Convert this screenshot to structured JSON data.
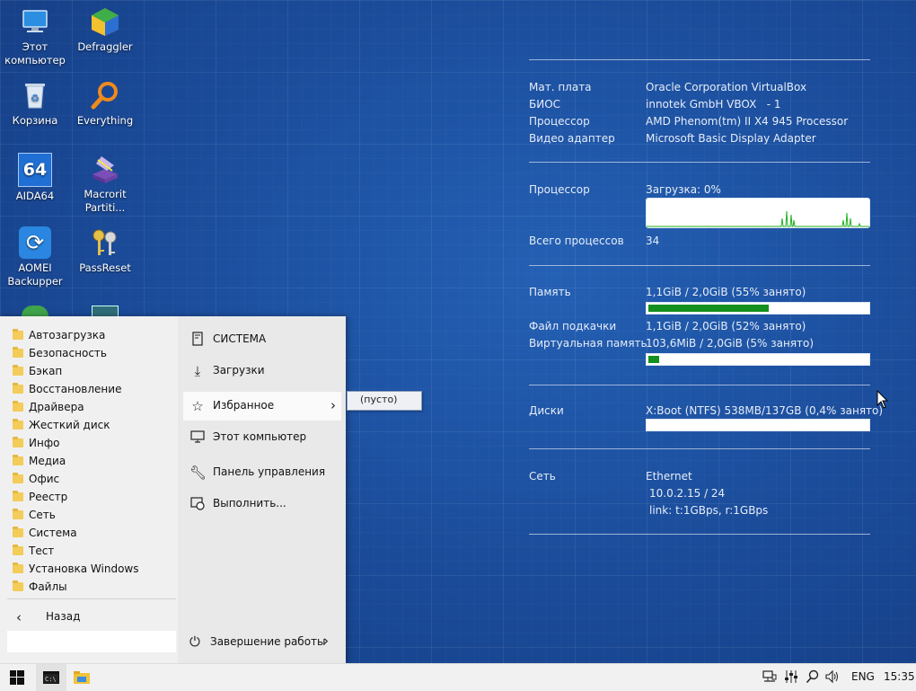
{
  "desktop": {
    "icons": [
      {
        "label": "Этот компьютер"
      },
      {
        "label": "Defraggler"
      },
      {
        "label": "Корзина"
      },
      {
        "label": "Everything"
      },
      {
        "label": "AIDA64",
        "badge": "64"
      },
      {
        "label": "Macrorit Partiti..."
      },
      {
        "label": "AOMEI Backupper"
      },
      {
        "label": "PassReset"
      }
    ]
  },
  "sysinfo": {
    "motherboard": {
      "label": "Мат. плата",
      "value": "Oracle Corporation VirtualBox"
    },
    "bios": {
      "label": "БИОС",
      "value": "innotek GmbH VBOX   - 1"
    },
    "cpu": {
      "label": "Процессор",
      "value": "AMD Phenom(tm) II X4 945 Processor"
    },
    "video": {
      "label": "Видео адаптер",
      "value": "Microsoft Basic Display Adapter"
    },
    "cpu_load": {
      "label": "Процессор",
      "value": "Загрузка:  0%"
    },
    "processes": {
      "label": "Всего процессов",
      "value": "34"
    },
    "memory": {
      "label": "Память",
      "value": "1,1GiB / 2,0GiB (55% занято)",
      "percent": 55
    },
    "pagefile": {
      "label": "Файл подкачки",
      "value": "1,1GiB / 2,0GiB (52% занято)"
    },
    "virtual": {
      "label": "Виртуальная память",
      "value": "103,6MiB / 2,0GiB (5% занято)",
      "percent": 5
    },
    "disks": {
      "label": "Диски",
      "value": "X:Boot (NTFS) 538MB/137GB (0,4% занято)",
      "percent": 0.4
    },
    "network": {
      "label": "Сеть",
      "adapter": "Ethernet",
      "ip": "10.0.2.15 / 24",
      "link": "link: t:1GBps, r:1GBps"
    }
  },
  "startmenu": {
    "folders": [
      "Автозагрузка",
      "Безопасность",
      "Бэкап",
      "Восстановление",
      "Драйвера",
      "Жесткий диск",
      "Инфо",
      "Медиа",
      "Офис",
      "Реестр",
      "Сеть",
      "Система",
      "Тест",
      "Установка Windows",
      "Файлы"
    ],
    "back_label": "Назад",
    "search_placeholder": "",
    "right_items": {
      "system": "СИСТЕМА",
      "downloads": "Загрузки",
      "favorites": "Избранное",
      "this_pc": "Этот компьютер",
      "control_panel": "Панель управления",
      "run": "Выполнить..."
    },
    "shutdown_label": "Завершение работы",
    "favorites_popup": "(пусто)"
  },
  "taskbar": {
    "language": "ENG",
    "time": "15:35"
  },
  "colors": {
    "desktop_bg": "#1c4f9e",
    "bar_fill": "#13901e",
    "menu_bg": "#e9e9e9"
  }
}
